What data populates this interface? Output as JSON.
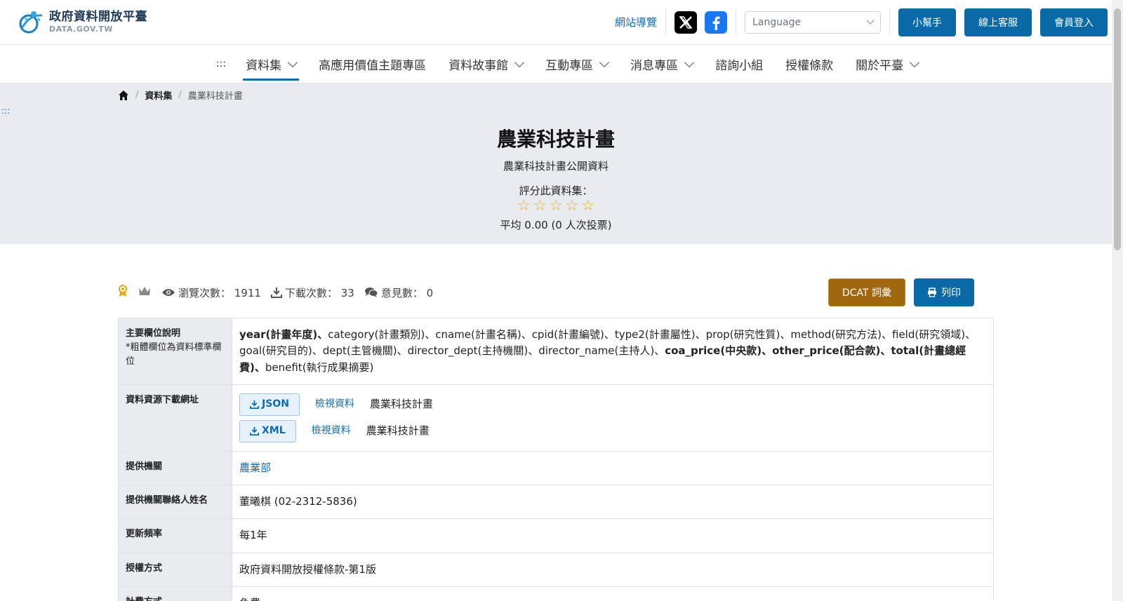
{
  "header": {
    "logo_title": "政府資料開放平臺",
    "logo_sub": "DATA.GOV.TW",
    "site_nav": "網站導覽",
    "language_placeholder": "Language",
    "buttons": [
      "小幫手",
      "線上客服",
      "會員登入"
    ],
    "colors": {
      "primary": "#0a6aa8",
      "dcat": "#a0670e"
    }
  },
  "nav": {
    "anchor": ":::",
    "items": [
      {
        "label": "資料集",
        "dropdown": true,
        "active": true
      },
      {
        "label": "高應用價值主題專區",
        "dropdown": false
      },
      {
        "label": "資料故事館",
        "dropdown": true
      },
      {
        "label": "互動專區",
        "dropdown": true
      },
      {
        "label": "消息專區",
        "dropdown": true
      },
      {
        "label": "諮詢小組",
        "dropdown": false
      },
      {
        "label": "授權條款",
        "dropdown": false
      },
      {
        "label": "關於平臺",
        "dropdown": true
      }
    ]
  },
  "breadcrumb": {
    "sep": "/",
    "parent": "資料集",
    "current": "農業科技計畫"
  },
  "side_anchor": ":::",
  "hero": {
    "title": "農業科技計畫",
    "description": "農業科技計畫公開資料",
    "rate_label": "評分此資料集：",
    "star_count": 5,
    "rating": 0,
    "avg_text": "平均 0.00 (0 人次投票)"
  },
  "stats": {
    "views": "瀏覽次數： 1911",
    "downloads": "下載次數： 33",
    "comments": "意見數： 0",
    "dcat_label": "DCAT 詞彙",
    "print_label": "列印"
  },
  "table": {
    "fields_label": "主要欄位說明",
    "fields_note": "*粗體欄位為資料標準欄位",
    "fields_segments": [
      {
        "text": "year(計畫年度)",
        "bold": true
      },
      {
        "text": "、",
        "bold": true
      },
      {
        "text": "category(計畫類別)、cname(計畫名稱)、cpid(計畫編號)、type2(計畫屬性)、prop(研究性質)、method(研究方法)、field(研究領域)、goal(研究目的)、dept(主管機關)、director_dept(主持機關)、director_name(主持人)、",
        "bold": false
      },
      {
        "text": "coa_price(中央款)",
        "bold": true
      },
      {
        "text": "、",
        "bold": true
      },
      {
        "text": "other_price(配合款)",
        "bold": true
      },
      {
        "text": "、",
        "bold": true
      },
      {
        "text": "total(計畫總經費)",
        "bold": true
      },
      {
        "text": "、",
        "bold": true
      },
      {
        "text": "benefit(執行成果摘要)",
        "bold": false
      }
    ],
    "resources_label": "資料資源下載網址",
    "resources": [
      {
        "format": "JSON",
        "view": "檢視資料",
        "name": "農業科技計畫"
      },
      {
        "format": "XML",
        "view": "檢視資料",
        "name": "農業科技計畫"
      }
    ],
    "provider_label": "提供機關",
    "provider": "農業部",
    "contact_label": "提供機關聯絡人姓名",
    "contact": "董曦棋 (02-2312-5836)",
    "frequency_label": "更新頻率",
    "frequency": "每1年",
    "license_label": "授權方式",
    "license": "政府資料開放授權條款-第1版",
    "fee_label": "計費方式",
    "fee": "免費"
  }
}
